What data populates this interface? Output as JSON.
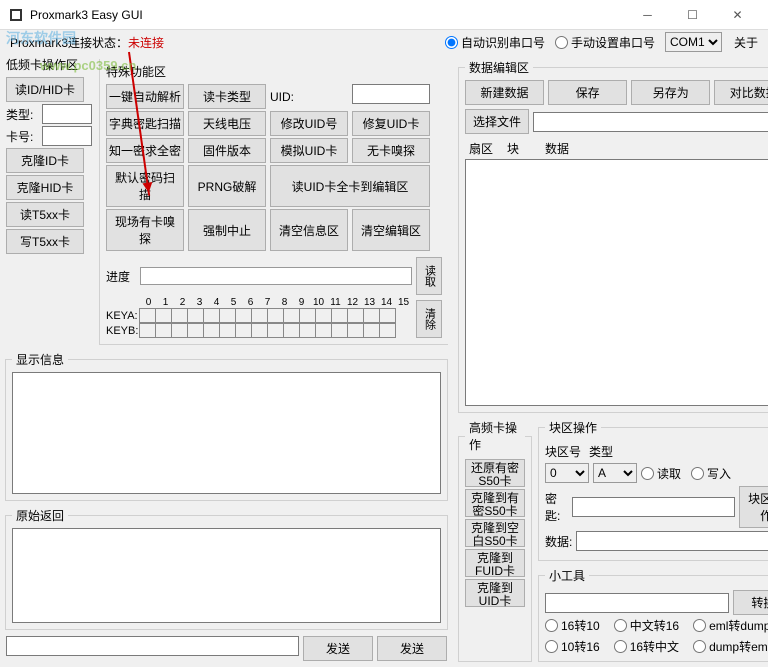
{
  "window": {
    "title": "Proxmark3 Easy GUI"
  },
  "watermark": {
    "brand": "河东软件园",
    "url": "www.pc0359.cn"
  },
  "conn": {
    "label": "Proxmark3连接状态：",
    "status": "未连接"
  },
  "topbar": {
    "auto_port": "自动识别串口号",
    "manual_port": "手动设置串口号",
    "port_value": "COM1",
    "about": "关于"
  },
  "low": {
    "title": "低频卡操作区",
    "read_id": "读ID/HID卡",
    "type_label": "类型:",
    "card_label": "卡号:",
    "clone_id": "克隆ID卡",
    "clone_hid": "克隆HID卡",
    "read_t5": "读T5xx卡",
    "write_t5": "写T5xx卡"
  },
  "special": {
    "title": "特殊功能区",
    "one_key": "一键自动解析",
    "read_type": "读卡类型",
    "uid_label": "UID:",
    "dict_scan": "字典密匙扫描",
    "ant_volt": "天线电压",
    "mod_uid": "修改UID号",
    "fix_uid": "修复UID卡",
    "one_key_all": "知一密求全密",
    "fw_ver": "固件版本",
    "sim_uid": "模拟UID卡",
    "no_sniff": "无卡嗅探",
    "def_pwd": "默认密码扫描",
    "prng": "PRNG破解",
    "read_uid_all": "读UID卡全卡到编辑区",
    "field_sniff": "现场有卡嗅探",
    "force_stop": "强制中止",
    "clear_info": "清空信息区",
    "clear_edit": "清空编辑区",
    "progress": "进度",
    "read": "读取",
    "clear": "清除",
    "keya": "KEYA:",
    "keyb": "KEYB:",
    "cols": [
      "0",
      "1",
      "2",
      "3",
      "4",
      "5",
      "6",
      "7",
      "8",
      "9",
      "10",
      "11",
      "12",
      "13",
      "14",
      "15"
    ]
  },
  "display_info": {
    "title": "显示信息"
  },
  "raw": {
    "title": "原始返回",
    "send": "发送",
    "send_btn": "发送"
  },
  "data_edit": {
    "title": "数据编辑区",
    "new": "新建数据",
    "save": "保存",
    "save_as": "另存为",
    "compare": "对比数据",
    "select_file": "选择文件",
    "col_sector": "扇区",
    "col_block": "块",
    "col_data": "数据"
  },
  "hf": {
    "title": "高频卡操作",
    "restore_s50": "还原有密S50卡",
    "clone_s50_pwd": "克隆到有密S50卡",
    "clone_s50_blank": "克隆到空白S50卡",
    "clone_fuid": "克隆到FUID卡",
    "clone_uid": "克隆到UID卡"
  },
  "block": {
    "title": "块区操作",
    "block_no": "块区号",
    "type": "类型",
    "block_no_val": "0",
    "type_val": "A",
    "read": "读取",
    "write": "写入",
    "key": "密匙:",
    "op_btn": "块区操作",
    "data": "数据:"
  },
  "tools": {
    "title": "小工具",
    "convert": "转换",
    "r1": "16转10",
    "r2": "中文转16",
    "r3": "eml转dump",
    "r4": "10转16",
    "r5": "16转中文",
    "r6": "dump转eml"
  }
}
